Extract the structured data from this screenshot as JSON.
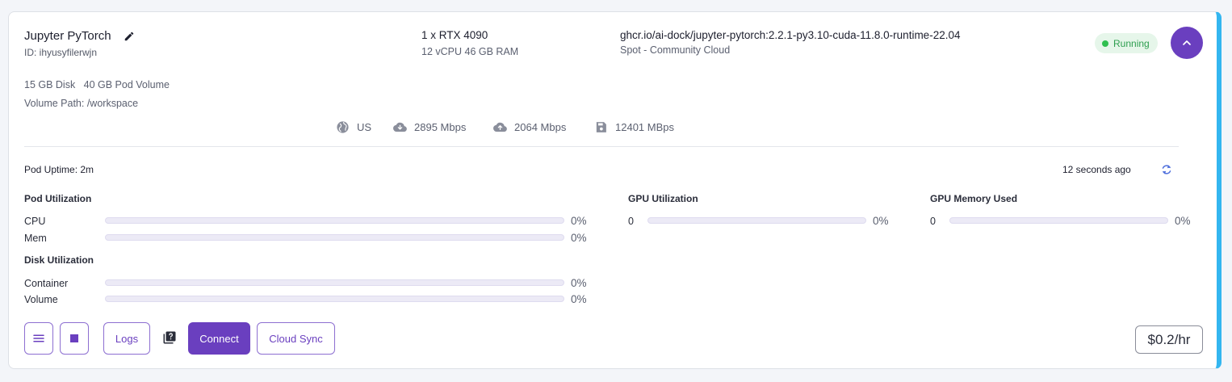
{
  "pod": {
    "name": "Jupyter PyTorch",
    "id": "ID: ihyusyfilerwjn",
    "gpu": "1 x RTX 4090",
    "cpu_ram": "12 vCPU 46 GB RAM",
    "image": "ghcr.io/ai-dock/jupyter-pytorch:2.2.1-py3.10-cuda-11.8.0-runtime-22.04",
    "cloud": "Spot - Community Cloud",
    "status": "Running",
    "disk": "15 GB Disk",
    "pod_volume": "40 GB Pod Volume",
    "volume_path": "Volume Path: /workspace"
  },
  "stats": {
    "region": "US",
    "download": "2895 Mbps",
    "upload": "2064 Mbps",
    "disk_speed": "12401 MBps"
  },
  "metrics": {
    "uptime": "Pod Uptime: 2m",
    "updated": "12 seconds ago",
    "pod_util_title": "Pod Utilization",
    "cpu_label": "CPU",
    "cpu_value": "0%",
    "mem_label": "Mem",
    "mem_value": "0%",
    "disk_util_title": "Disk Utilization",
    "container_label": "Container",
    "container_value": "0%",
    "volume_label": "Volume",
    "volume_value": "0%",
    "gpu_util_title": "GPU Utilization",
    "gpu_index": "0",
    "gpu_value": "0%",
    "gpu_mem_title": "GPU Memory Used",
    "gpu_mem_index": "0",
    "gpu_mem_value": "0%"
  },
  "actions": {
    "logs": "Logs",
    "connect": "Connect",
    "cloud_sync": "Cloud Sync",
    "price": "$0.2/hr"
  },
  "colors": {
    "accent": "#6a3fbf",
    "running_green": "#2fbf4f",
    "edge_blue": "#33b6f0"
  },
  "icons": [
    "edit-icon",
    "chevron-up-icon",
    "globe-icon",
    "cloud-download-icon",
    "cloud-upload-icon",
    "save-icon",
    "refresh-icon",
    "menu-icon",
    "stop-icon",
    "help-docs-icon"
  ]
}
